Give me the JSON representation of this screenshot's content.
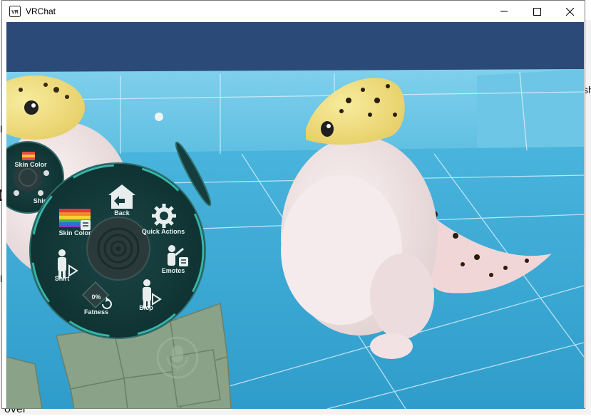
{
  "window": {
    "title": "VRChat",
    "app_icon": "vrchat-logo-icon",
    "controls": [
      "minimize-icon",
      "maximize-icon",
      "close-icon"
    ]
  },
  "background_fragments": {
    "left_text": "Pr",
    "left_text_2": "D",
    "left_text_3": "Ri",
    "right_text": "sh",
    "bottom_text": "over"
  },
  "action_menu": {
    "center_icon": "target-rings-icon",
    "items": [
      {
        "label": "Back",
        "icon": "back-house-icon"
      },
      {
        "label": "Quick Actions",
        "icon": "gear-icon"
      },
      {
        "label": "Emotes",
        "icon": "emote-figure-icon"
      },
      {
        "label": "Blep",
        "icon": "figure-play-icon"
      },
      {
        "label": "Fatness",
        "icon": "refresh-icon",
        "value": "0%"
      },
      {
        "label": "Shirt",
        "icon": "figure-play-icon"
      },
      {
        "label": "Skin Color",
        "icon": "rainbow-flag-icon"
      }
    ]
  },
  "secondary_menu": {
    "labels": [
      "Skin Color",
      "Shirt"
    ]
  },
  "microphone": {
    "icon": "microphone-icon"
  },
  "colors": {
    "sky": "#2c4a78",
    "floor": "#3aa4d0",
    "wall": "#6fc6e4",
    "menu_bg": "#153d3d",
    "menu_ring": "#2f6e6c",
    "menu_accent": "#38c4b6"
  }
}
